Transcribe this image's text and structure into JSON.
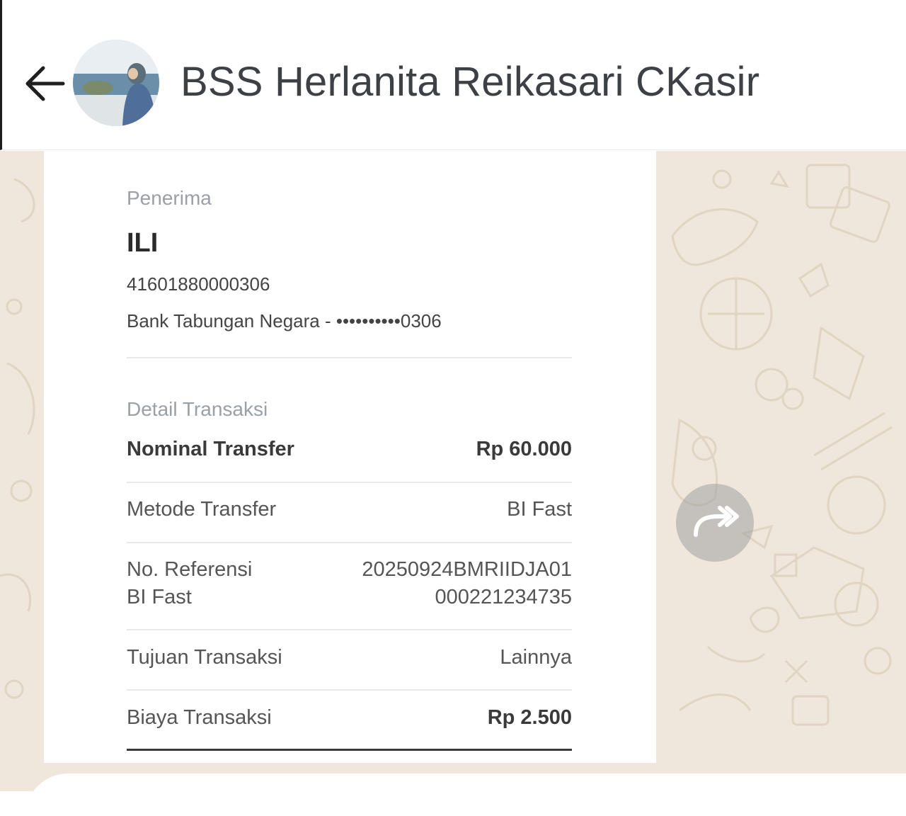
{
  "header": {
    "title": "BSS Herlanita Reikasari CKasir"
  },
  "receipt": {
    "recipient_label": "Penerima",
    "recipient_name": "ILI",
    "account_number": "41601880000306",
    "bank_line": "Bank Tabungan Negara - ••••••••••0306",
    "detail_label": "Detail Transaksi",
    "rows": [
      {
        "label": "Nominal Transfer",
        "value": "Rp 60.000"
      },
      {
        "label": "Metode Transfer",
        "value": "BI Fast"
      },
      {
        "label_line1": "No. Referensi",
        "label_line2": "BI Fast",
        "value_line1": "20250924BMRIIDJA01",
        "value_line2": "000221234735"
      },
      {
        "label": "Tujuan Transaksi",
        "value": "Lainnya"
      },
      {
        "label": "Biaya Transaksi",
        "value": "Rp 2.500"
      }
    ]
  },
  "icons": {
    "back": "arrow-left-icon",
    "forward": "forward-arrow-icon"
  },
  "colors": {
    "chat_background": "#efe7dc",
    "title_text": "#3d4044"
  }
}
